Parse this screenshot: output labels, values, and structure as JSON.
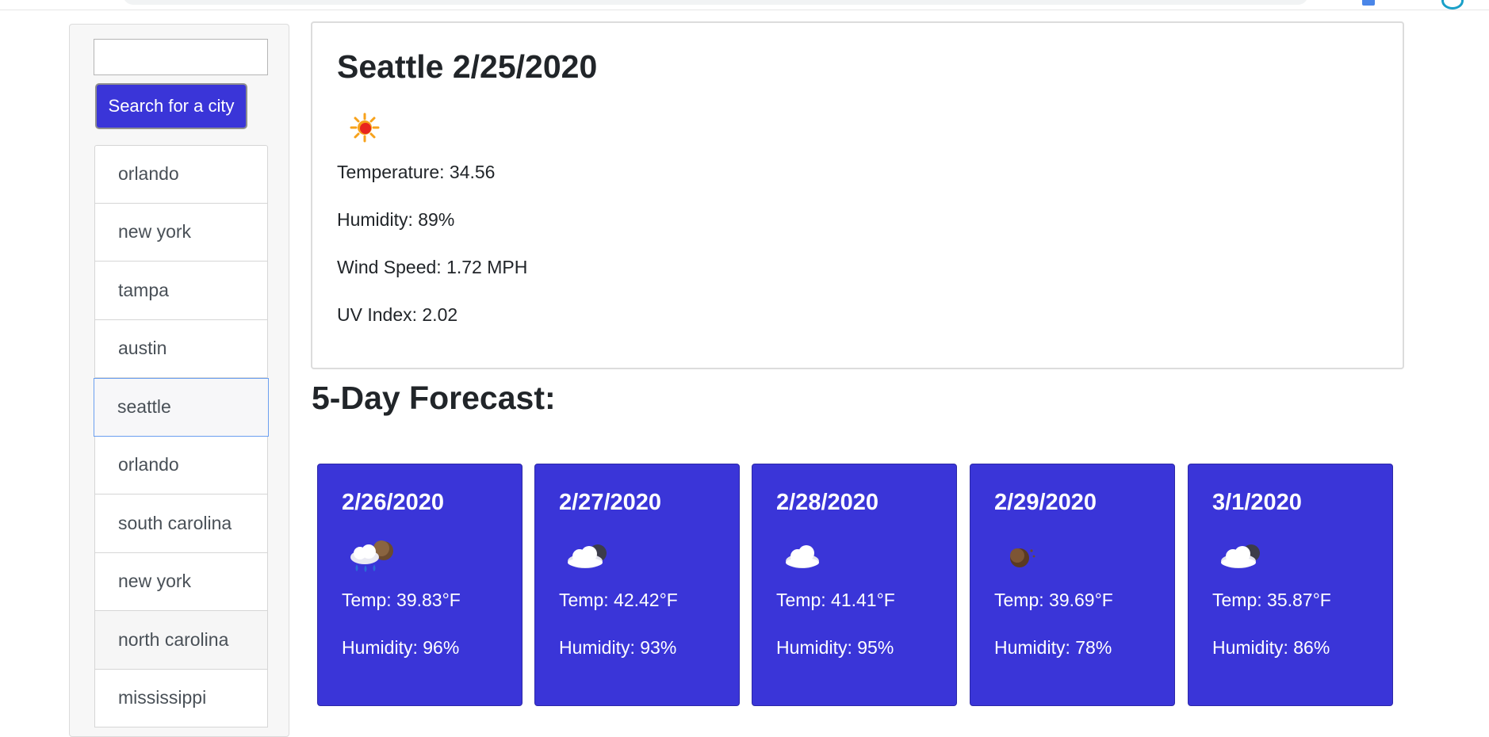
{
  "search": {
    "placeholder": "",
    "button_label": "Search for a city"
  },
  "cities": [
    {
      "name": "orlando"
    },
    {
      "name": "new york"
    },
    {
      "name": "tampa"
    },
    {
      "name": "austin"
    },
    {
      "name": "seattle"
    },
    {
      "name": "orlando"
    },
    {
      "name": "south carolina"
    },
    {
      "name": "new york"
    },
    {
      "name": "north carolina"
    },
    {
      "name": "mississippi"
    }
  ],
  "current": {
    "title": "Seattle 2/25/2020",
    "icon": "sun-icon",
    "temperature": "Temperature: 34.56",
    "humidity": "Humidity: 89%",
    "wind": "Wind Speed: 1.72 MPH",
    "uv": "UV Index: 2.02"
  },
  "forecast_heading": "5-Day Forecast:",
  "forecast": [
    {
      "date": "2/26/2020",
      "icon": "rain-night-icon",
      "temp": "Temp: 39.83°F",
      "humidity": "Humidity: 96%"
    },
    {
      "date": "2/27/2020",
      "icon": "cloud-night-icon",
      "temp": "Temp: 42.42°F",
      "humidity": "Humidity: 93%"
    },
    {
      "date": "2/28/2020",
      "icon": "cloud-icon",
      "temp": "Temp: 41.41°F",
      "humidity": "Humidity: 95%"
    },
    {
      "date": "2/29/2020",
      "icon": "moon-icon",
      "temp": "Temp: 39.69°F",
      "humidity": "Humidity: 78%"
    },
    {
      "date": "3/1/2020",
      "icon": "cloud-night-icon",
      "temp": "Temp: 35.87°F",
      "humidity": "Humidity: 86%"
    }
  ],
  "colors": {
    "accent": "#3a35d8",
    "active_border": "#6b9ff0"
  }
}
